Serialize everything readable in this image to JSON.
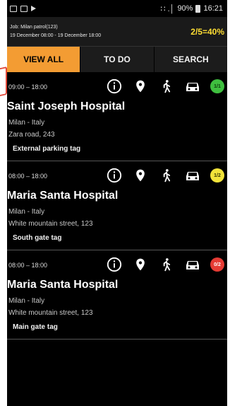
{
  "status_bar": {
    "signal": "∷ .│",
    "battery": "90%",
    "time": "16:21"
  },
  "header": {
    "job_label": "Job: Milan patrol(123)",
    "date_range": "19 December 08:00 - 19 December 18:00",
    "progress": "2/5=40%"
  },
  "tabs": [
    {
      "label": "VIEW ALL",
      "active": true
    },
    {
      "label": "TO DO",
      "active": false
    },
    {
      "label": "SEARCH",
      "active": false
    }
  ],
  "checkpoints": [
    {
      "time": "09:00 – 18:00",
      "name": "Saint Joseph Hospital",
      "city": "Milan - Italy",
      "address": "Zara road, 243",
      "tag": "External parking tag",
      "badge": "1/1",
      "badge_color": "#3fbf3f",
      "badge_text_color": "#0a3a0a"
    },
    {
      "time": "08:00 – 18:00",
      "name": "Maria Santa Hospital",
      "city": "Milan - Italy",
      "address": "White mountain street, 123",
      "tag": "South gate tag",
      "badge": "1/2",
      "badge_color": "#f2e33a",
      "badge_text_color": "#333300"
    },
    {
      "time": "08:00 – 18:00",
      "name": "Maria Santa Hospital",
      "city": "Milan - Italy",
      "address": "White mountain street, 123",
      "tag": "Main gate tag",
      "badge": "0/2",
      "badge_color": "#e53b34",
      "badge_text_color": "#ffffff"
    }
  ],
  "icons": {
    "info": "info-icon",
    "location": "location-pin-icon",
    "walk": "walking-person-icon",
    "car": "car-icon"
  },
  "colors": {
    "accent": "#f39c33",
    "background": "#000000"
  }
}
